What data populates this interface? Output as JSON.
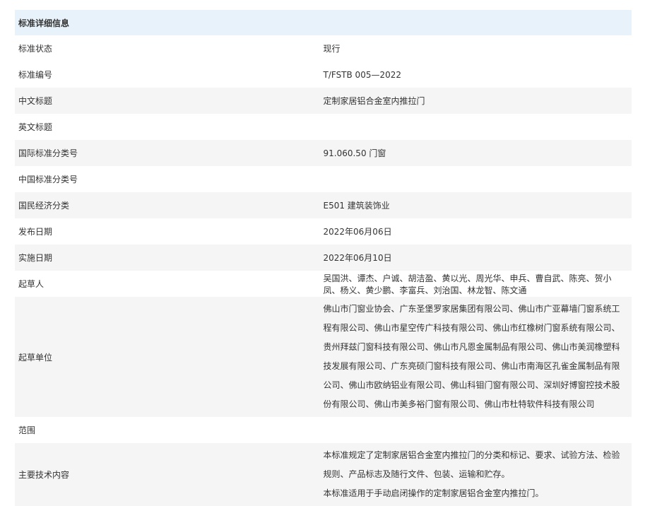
{
  "header": "标准详细信息",
  "rows": [
    {
      "label": "标准状态",
      "value": "现行"
    },
    {
      "label": "标准编号",
      "value": "T/FSTB 005—2022"
    },
    {
      "label": "中文标题",
      "value": "定制家居铝合金室内推拉门"
    },
    {
      "label": "英文标题",
      "value": ""
    },
    {
      "label": "国际标准分类号",
      "value": "91.060.50 门窗"
    },
    {
      "label": "中国标准分类号",
      "value": ""
    },
    {
      "label": "国民经济分类",
      "value": "E501 建筑装饰业"
    },
    {
      "label": "发布日期",
      "value": "2022年06月06日"
    },
    {
      "label": "实施日期",
      "value": "2022年06月10日"
    },
    {
      "label": "起草人",
      "value": "吴国洪、谭杰、户诚、胡洁盈、黄以光、周光华、申兵、曹自武、陈亮、贺小凤、杨义、黄少鹏、李富兵、刘治国、林龙智、陈文通"
    },
    {
      "label": "起草单位",
      "value": "佛山市门窗业协会、广东圣堡罗家居集团有限公司、佛山市广亚幕墙门窗系统工程有限公司、佛山市星空传广科技有限公司、佛山市红橡树门窗系统有限公司、贵州拜兹门窗科技有限公司、佛山市凡恩金属制品有限公司、佛山市美润橡塑科技发展有限公司、广东亮硕门窗科技有限公司、佛山市南海区孔雀金属制品有限公司、佛山市欧纳铝业有限公司、佛山科钼门窗有限公司、深圳好博窗控技术股份有限公司、佛山市美多裕门窗有限公司、佛山市杜特软件科技有限公司"
    },
    {
      "label": "范围",
      "value": ""
    },
    {
      "label": "主要技术内容",
      "lines": [
        "本标准规定了定制家居铝合金室内推拉门的分类和标记、要求、试验方法、检验规则、产品标志及随行文件、包装、运输和贮存。",
        "本标准适用于手动启闭操作的定制家居铝合金室内推拉门。"
      ]
    }
  ]
}
